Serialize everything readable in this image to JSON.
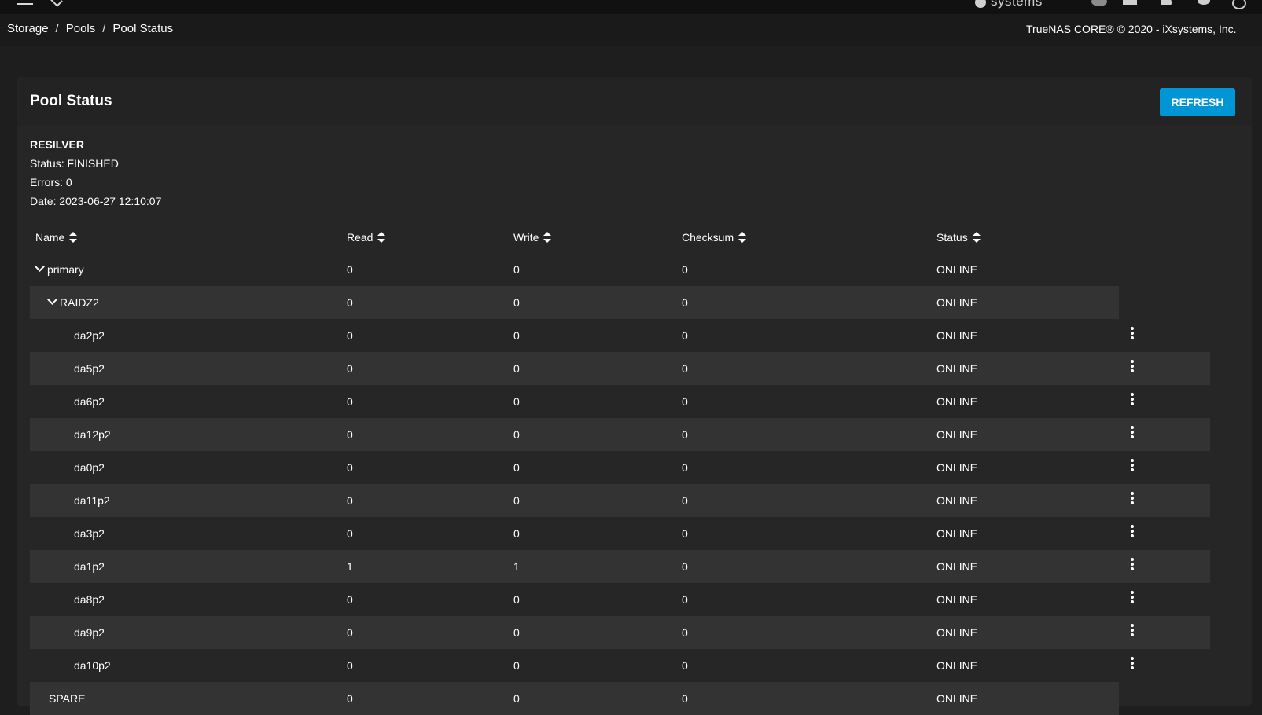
{
  "breadcrumb": {
    "items": [
      "Storage",
      "Pools",
      "Pool Status"
    ],
    "separator": "/"
  },
  "copyright": "TrueNAS CORE® © 2020 - iXsystems, Inc.",
  "topbar": {
    "logo_text": "systems"
  },
  "card": {
    "title": "Pool Status",
    "refresh_label": "REFRESH"
  },
  "scan": {
    "type": "RESILVER",
    "status": "Status: FINISHED",
    "errors": "Errors: 0",
    "date": "Date: 2023-06-27 12:10:07"
  },
  "columns": {
    "name": "Name",
    "read": "Read",
    "write": "Write",
    "checksum": "Checksum",
    "status": "Status"
  },
  "rows": [
    {
      "name": "primary",
      "read": "0",
      "write": "0",
      "checksum": "0",
      "status": "ONLINE",
      "level": 0,
      "expandable": true,
      "menu": false
    },
    {
      "name": "RAIDZ2",
      "read": "0",
      "write": "0",
      "checksum": "0",
      "status": "ONLINE",
      "level": 1,
      "expandable": true,
      "menu": false
    },
    {
      "name": "da2p2",
      "read": "0",
      "write": "0",
      "checksum": "0",
      "status": "ONLINE",
      "level": 2,
      "expandable": false,
      "menu": true
    },
    {
      "name": "da5p2",
      "read": "0",
      "write": "0",
      "checksum": "0",
      "status": "ONLINE",
      "level": 2,
      "expandable": false,
      "menu": true
    },
    {
      "name": "da6p2",
      "read": "0",
      "write": "0",
      "checksum": "0",
      "status": "ONLINE",
      "level": 2,
      "expandable": false,
      "menu": true
    },
    {
      "name": "da12p2",
      "read": "0",
      "write": "0",
      "checksum": "0",
      "status": "ONLINE",
      "level": 2,
      "expandable": false,
      "menu": true
    },
    {
      "name": "da0p2",
      "read": "0",
      "write": "0",
      "checksum": "0",
      "status": "ONLINE",
      "level": 2,
      "expandable": false,
      "menu": true
    },
    {
      "name": "da11p2",
      "read": "0",
      "write": "0",
      "checksum": "0",
      "status": "ONLINE",
      "level": 2,
      "expandable": false,
      "menu": true
    },
    {
      "name": "da3p2",
      "read": "0",
      "write": "0",
      "checksum": "0",
      "status": "ONLINE",
      "level": 2,
      "expandable": false,
      "menu": true
    },
    {
      "name": "da1p2",
      "read": "1",
      "write": "1",
      "checksum": "0",
      "status": "ONLINE",
      "level": 2,
      "expandable": false,
      "menu": true
    },
    {
      "name": "da8p2",
      "read": "0",
      "write": "0",
      "checksum": "0",
      "status": "ONLINE",
      "level": 2,
      "expandable": false,
      "menu": true
    },
    {
      "name": "da9p2",
      "read": "0",
      "write": "0",
      "checksum": "0",
      "status": "ONLINE",
      "level": 2,
      "expandable": false,
      "menu": true
    },
    {
      "name": "da10p2",
      "read": "0",
      "write": "0",
      "checksum": "0",
      "status": "ONLINE",
      "level": 2,
      "expandable": false,
      "menu": true
    },
    {
      "name": "SPARE",
      "read": "0",
      "write": "0",
      "checksum": "0",
      "status": "ONLINE",
      "level": 1,
      "expandable": false,
      "menu": false
    }
  ]
}
